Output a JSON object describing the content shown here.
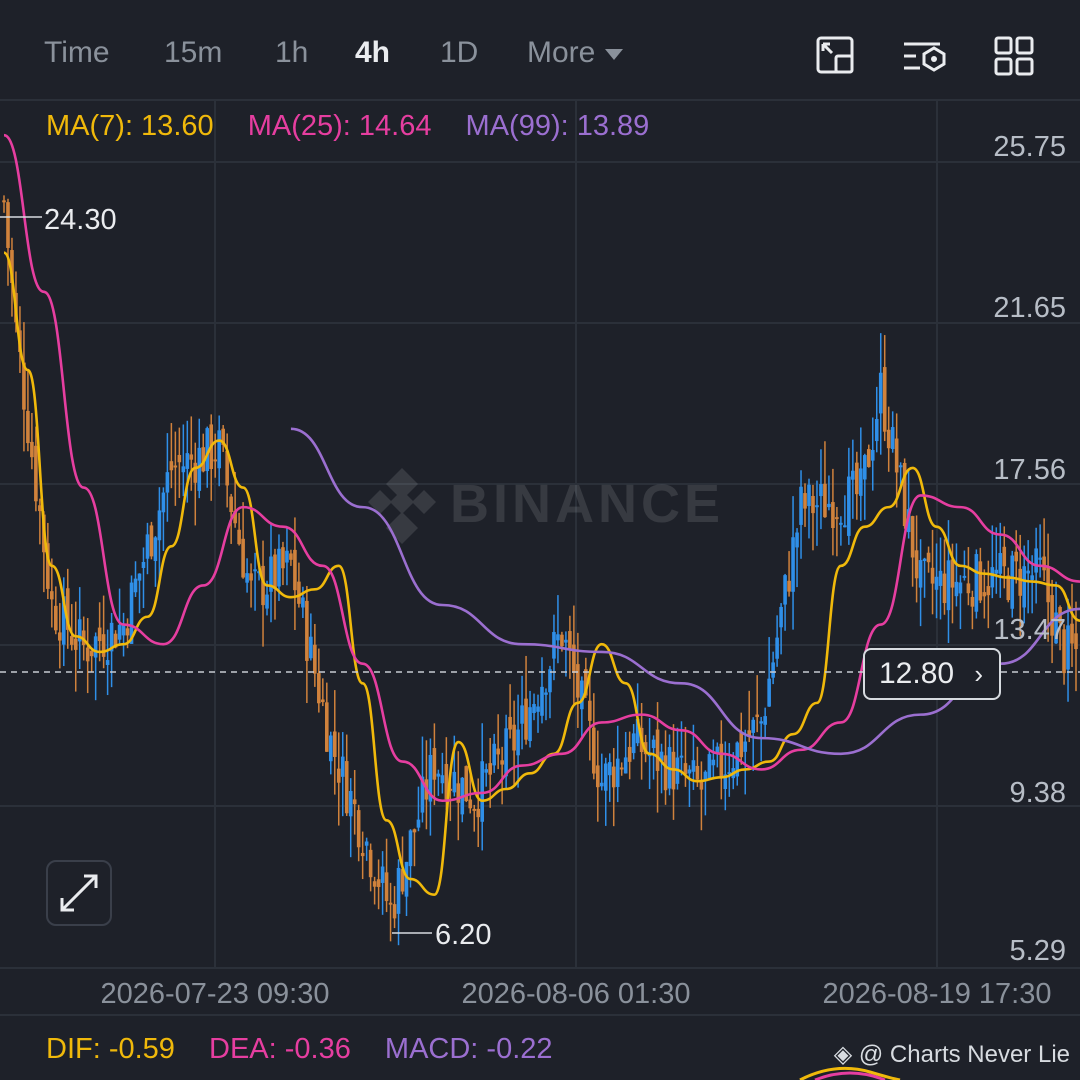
{
  "header": {
    "tabs": [
      {
        "label": "Time"
      },
      {
        "label": "15m"
      },
      {
        "label": "1h"
      },
      {
        "label": "4h",
        "active": true
      },
      {
        "label": "1D"
      },
      {
        "label": "More"
      }
    ],
    "tools": [
      "chart-settings-icon",
      "indicator-settings-icon",
      "grid-layout-icon"
    ]
  },
  "ma_legend": {
    "ma7": "MA(7): 13.60",
    "ma25": "MA(25): 14.64",
    "ma99": "MA(99): 13.89"
  },
  "macd_legend": {
    "dif": "DIF: -0.59",
    "dea": "DEA: -0.36",
    "macd": "MACD: -0.22"
  },
  "watermark": "BINANCE",
  "credit": "@ Charts Never Lie",
  "colors": {
    "background": "#1e2129",
    "grid": "#2b3039",
    "up": "#2f8fe8",
    "down": "#d0823c",
    "ma7": "#f0b90b",
    "ma25": "#e63ea0",
    "ma99": "#9b6fd0",
    "text": "#b7bdc6"
  },
  "chart_data": {
    "type": "line",
    "y_ticks": [
      "25.75",
      "21.65",
      "17.56",
      "13.47",
      "9.38",
      "5.29"
    ],
    "ylim": [
      5.29,
      25.75
    ],
    "x_ticks": [
      "2026-07-23 09:30",
      "2026-08-06 01:30",
      "2026-08-19 17:30"
    ],
    "high_label": "24.30",
    "low_label": "6.20",
    "current_price": "12.80",
    "series": [
      {
        "name": "MA(7)",
        "x": [
          0,
          6,
          12,
          18,
          24,
          30,
          36,
          42,
          48,
          54,
          60,
          66,
          72,
          78,
          84,
          90,
          96,
          102,
          108,
          114,
          120,
          126,
          132,
          138,
          144,
          150,
          156,
          162,
          168,
          174,
          180,
          186,
          192,
          198,
          204,
          210,
          216,
          222,
          228,
          234,
          240,
          246,
          252,
          258,
          264,
          270
        ],
        "values": [
          23.0,
          20.0,
          15.0,
          13.2,
          12.8,
          13.0,
          13.7,
          15.5,
          17.5,
          18.2,
          17.0,
          14.5,
          14.2,
          14.4,
          15.0,
          12.0,
          8.5,
          7.0,
          6.6,
          10.5,
          9.0,
          9.3,
          9.7,
          10.2,
          11.5,
          13.0,
          12.0,
          10.2,
          9.8,
          9.5,
          9.6,
          9.8,
          10.0,
          10.7,
          11.5,
          15.0,
          16.0,
          16.5,
          17.5,
          16.0,
          15.0,
          14.8,
          14.7,
          14.6,
          14.5,
          13.6
        ]
      },
      {
        "name": "MA(25)",
        "x": [
          0,
          10,
          20,
          30,
          40,
          50,
          60,
          70,
          80,
          90,
          100,
          110,
          120,
          130,
          140,
          150,
          160,
          170,
          180,
          190,
          200,
          210,
          220,
          230,
          240,
          250,
          260,
          270
        ],
        "values": [
          26.0,
          22.0,
          17.0,
          13.5,
          13.0,
          14.5,
          16.5,
          16.0,
          15.0,
          12.5,
          10.0,
          9.0,
          9.2,
          9.9,
          10.2,
          11.0,
          11.2,
          10.8,
          10.2,
          9.8,
          10.3,
          11.0,
          13.5,
          16.8,
          16.5,
          15.8,
          15.0,
          14.6
        ]
      },
      {
        "name": "MA(99)",
        "x": [
          72,
          90,
          110,
          130,
          150,
          170,
          190,
          210,
          230,
          250,
          270
        ],
        "values": [
          18.5,
          16.5,
          14.0,
          13.0,
          12.8,
          12.0,
          10.6,
          10.2,
          11.2,
          12.5,
          13.9
        ]
      }
    ],
    "candles": {
      "count": 270,
      "segments": [
        [
          0,
          24.3,
          3,
          21
        ],
        [
          3,
          21,
          12,
          14
        ],
        [
          12,
          14,
          20,
          12.9
        ],
        [
          20,
          12.9,
          30,
          13.5
        ],
        [
          30,
          13.5,
          42,
          17.5
        ],
        [
          42,
          17.5,
          54,
          18
        ],
        [
          54,
          18,
          62,
          14.3
        ],
        [
          62,
          14.3,
          72,
          15
        ],
        [
          72,
          15,
          82,
          10.5
        ],
        [
          82,
          10.5,
          97,
          6.2
        ],
        [
          97,
          6.2,
          108,
          10
        ],
        [
          108,
          10,
          118,
          9.1
        ],
        [
          118,
          9.1,
          128,
          10.5
        ],
        [
          128,
          10.5,
          140,
          13.3
        ],
        [
          140,
          13.3,
          150,
          9.5
        ],
        [
          150,
          9.5,
          158,
          10.5
        ],
        [
          158,
          10.5,
          175,
          9.3
        ],
        [
          175,
          9.3,
          190,
          11
        ],
        [
          190,
          11,
          200,
          16.5
        ],
        [
          200,
          16.5,
          215,
          16.8
        ],
        [
          215,
          16.8,
          220,
          19.5
        ],
        [
          220,
          19.5,
          230,
          14.5
        ],
        [
          230,
          14.5,
          260,
          14.8
        ],
        [
          260,
          14.8,
          266,
          12.8
        ],
        [
          266,
          12.8,
          270,
          12.8
        ]
      ]
    }
  }
}
